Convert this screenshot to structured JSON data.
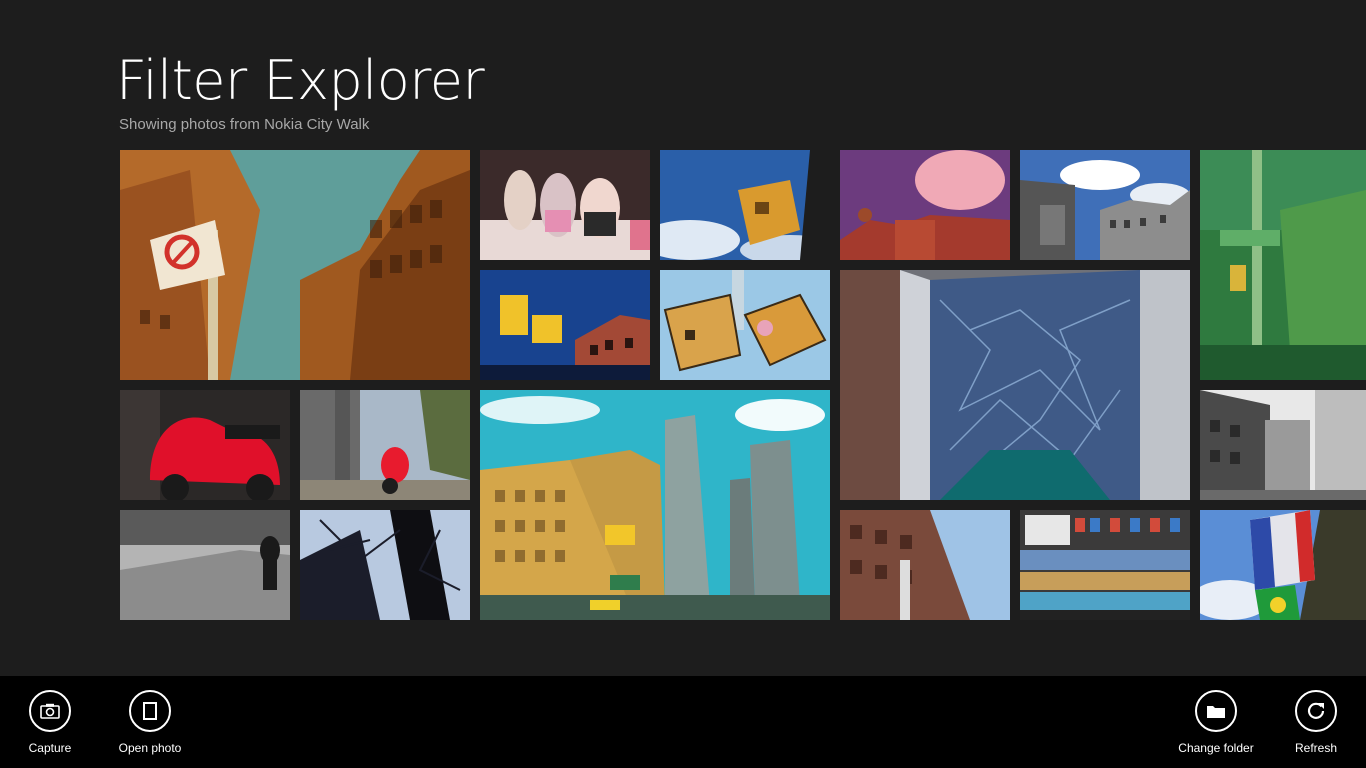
{
  "header": {
    "title": "Filter Explorer",
    "subtitle": "Showing photos from Nokia City Walk"
  },
  "photos": [
    {
      "name": "building-no-parking-sign",
      "tone": "sepia"
    },
    {
      "name": "stuffed-toys-window",
      "tone": "pink"
    },
    {
      "name": "traffic-signal-sky",
      "tone": "blue"
    },
    {
      "name": "purple-rooftop-clouds",
      "tone": "purple"
    },
    {
      "name": "building-billboard-sky",
      "tone": "gray"
    },
    {
      "name": "green-street-lamp",
      "tone": "green"
    },
    {
      "name": "yellow-signal-fire-escape",
      "tone": "blue"
    },
    {
      "name": "cartoon-signal",
      "tone": "yellow"
    },
    {
      "name": "mural-wall-awning",
      "tone": "teal"
    },
    {
      "name": "red-scooter",
      "tone": "red"
    },
    {
      "name": "alley-red-scooter",
      "tone": "gray"
    },
    {
      "name": "city-towers-taxi",
      "tone": "teal"
    },
    {
      "name": "grey-street-buildings",
      "tone": "gray"
    },
    {
      "name": "pedestrian-sidewalk",
      "tone": "mono"
    },
    {
      "name": "tree-branches-building",
      "tone": "dark"
    },
    {
      "name": "brick-building-sky",
      "tone": "brown"
    },
    {
      "name": "newsstand-shelves",
      "tone": "multi"
    },
    {
      "name": "flags-building",
      "tone": "blue"
    }
  ],
  "appbar": {
    "capture_label": "Capture",
    "open_photo_label": "Open photo",
    "change_folder_label": "Change folder",
    "refresh_label": "Refresh"
  },
  "colors": {
    "background": "#1d1d1d",
    "appbar": "#000000",
    "text": "#ffffff",
    "subtitle": "#a8a8a8"
  }
}
